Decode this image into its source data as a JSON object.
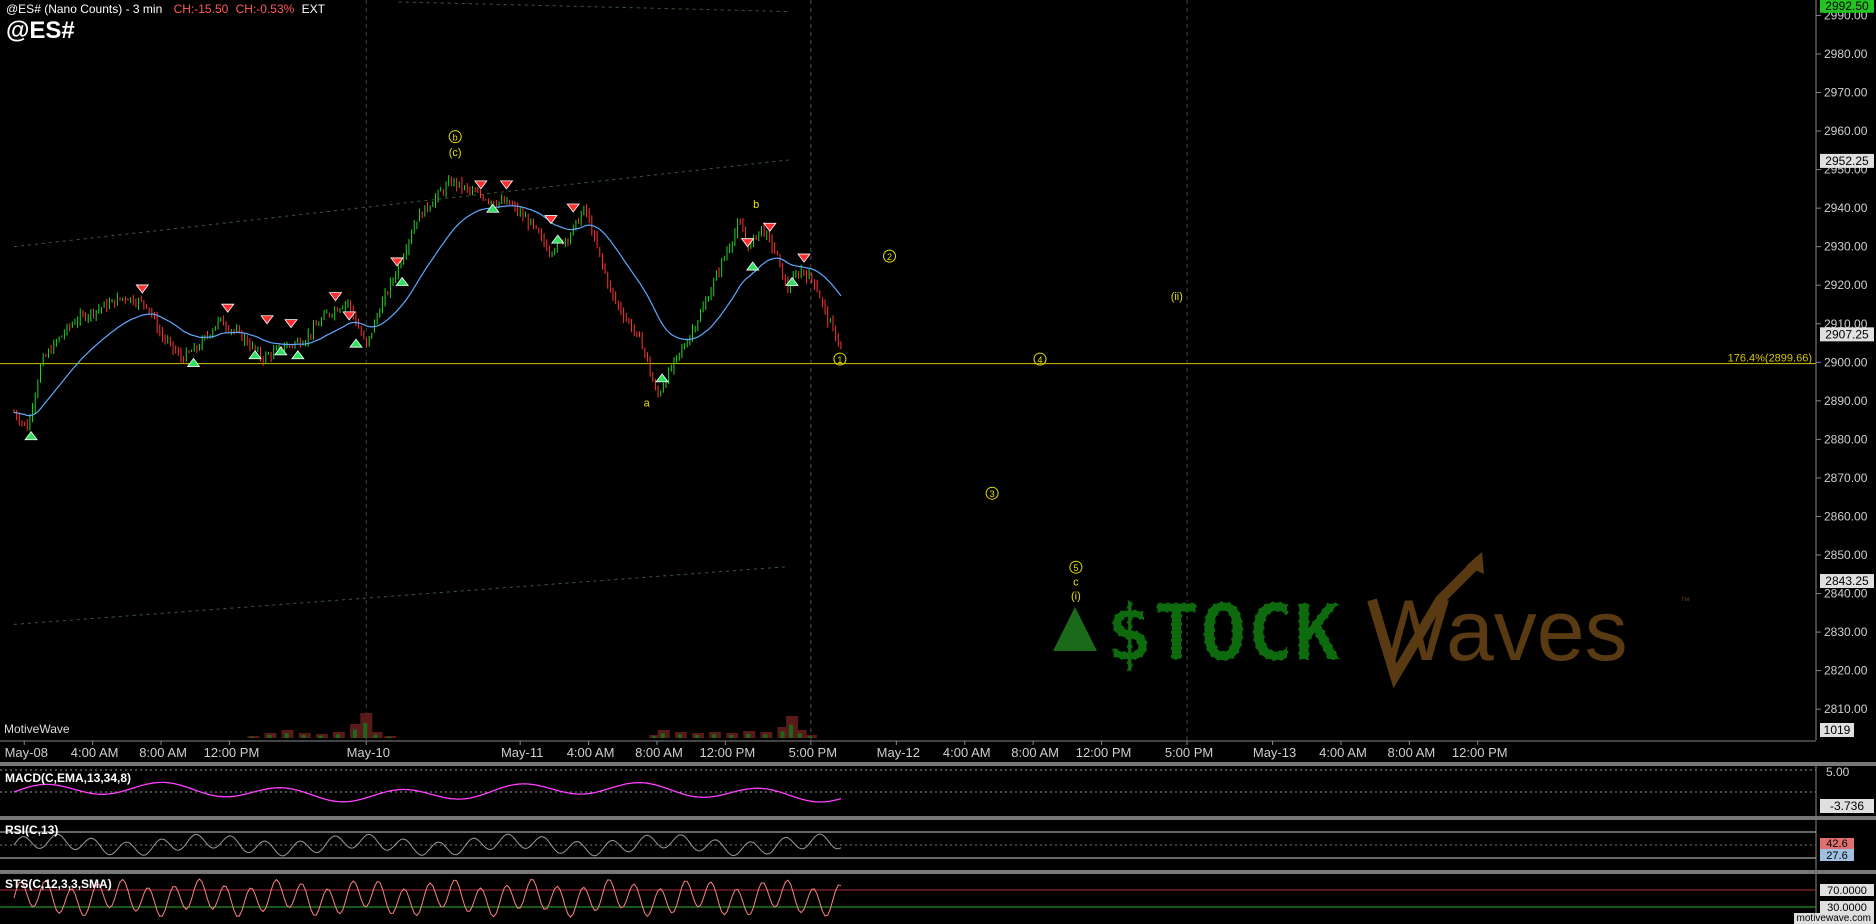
{
  "header": {
    "title": "@ES# (Nano Counts) - 3 min",
    "change_points": "CH:-15.50",
    "change_percent": "CH:-0.53%",
    "session": "EXT",
    "symbol": "@ES#",
    "watermark": "MotiveWave",
    "footer": "motivewave.com"
  },
  "colors": {
    "background": "#000000",
    "bull_candle": "#22d422",
    "bear_candle": "#ff3333",
    "ma_line": "#5fa8ff",
    "level_line": "#d4c400",
    "wave_label": "#e8e000",
    "macd_line": "#ff40ff",
    "rsi_line": "#9a9a9a",
    "stoch_line": "#ff8080"
  },
  "chart_data": {
    "type": "candlestick",
    "title": "@ES# (Nano Counts) - 3 min",
    "price_axis": {
      "ylim": [
        2802,
        2994
      ],
      "ticks": [
        2810,
        2820,
        2830,
        2840,
        2850,
        2860,
        2870,
        2880,
        2890,
        2900,
        2910,
        2920,
        2930,
        2940,
        2950,
        2960,
        2970,
        2980,
        2990
      ],
      "tick_labels": [
        "2810.00",
        "2820.00",
        "2830.00",
        "2840.00",
        "2850.00",
        "2860.00",
        "2870.00",
        "2880.00",
        "2890.00",
        "2900.00",
        "2910.00",
        "2920.00",
        "2930.00",
        "2940.00",
        "2950.00",
        "2960.00",
        "2970.00",
        "2980.00",
        "2990.00"
      ],
      "highlight_tags": [
        {
          "value": 2992.5,
          "label": "2992.50",
          "color": "#22c422"
        },
        {
          "value": 2952.25,
          "label": "2952.25",
          "color": "#e0e0e0"
        },
        {
          "value": 2907.25,
          "label": "2907.25",
          "color": "#e0e0e0"
        },
        {
          "value": 2843.25,
          "label": "2843.25",
          "color": "#e0e0e0"
        }
      ]
    },
    "time_axis": {
      "labels": [
        "May-08",
        "4:00 AM",
        "8:00 AM",
        "12:00 PM",
        "May-10",
        "May-11",
        "4:00 AM",
        "8:00 AM",
        "12:00 PM",
        "5:00 PM",
        "May-12",
        "4:00 AM",
        "8:00 AM",
        "12:00 PM",
        "5:00 PM",
        "May-13",
        "4:00 AM",
        "8:00 AM",
        "12:00 PM"
      ],
      "slot": [
        0.6,
        4.6,
        8.6,
        12.6,
        20.6,
        29.6,
        33.6,
        37.6,
        41.6,
        46.6,
        51.6,
        55.6,
        59.6,
        63.6,
        68.6,
        73.6,
        77.6,
        81.6,
        85.6
      ],
      "slot_max": 94.5,
      "session_breaks": [
        20.6,
        46.6,
        68.6
      ]
    },
    "price_path": [
      [
        0.0,
        2887
      ],
      [
        0.8,
        2883
      ],
      [
        1.6,
        2900
      ],
      [
        2.6,
        2906
      ],
      [
        3.6,
        2911
      ],
      [
        5.0,
        2914
      ],
      [
        6.5,
        2917
      ],
      [
        7.8,
        2915
      ],
      [
        8.6,
        2907
      ],
      [
        9.8,
        2901
      ],
      [
        10.8,
        2904
      ],
      [
        12.0,
        2911
      ],
      [
        13.5,
        2906
      ],
      [
        14.5,
        2901
      ],
      [
        15.8,
        2904
      ],
      [
        17.0,
        2906
      ],
      [
        18.2,
        2912
      ],
      [
        19.5,
        2916
      ],
      [
        20.6,
        2904
      ],
      [
        21.3,
        2913
      ],
      [
        22.5,
        2925
      ],
      [
        23.5,
        2937
      ],
      [
        24.5,
        2942
      ],
      [
        25.6,
        2947
      ],
      [
        26.8,
        2944
      ],
      [
        28.0,
        2942
      ],
      [
        29.0,
        2941
      ],
      [
        30.2,
        2936
      ],
      [
        31.3,
        2929
      ],
      [
        32.5,
        2933
      ],
      [
        33.4,
        2940
      ],
      [
        34.2,
        2928
      ],
      [
        35.0,
        2917
      ],
      [
        36.0,
        2910
      ],
      [
        36.8,
        2904
      ],
      [
        37.6,
        2891
      ],
      [
        38.4,
        2898
      ],
      [
        39.4,
        2906
      ],
      [
        40.4,
        2915
      ],
      [
        41.4,
        2926
      ],
      [
        42.4,
        2936
      ],
      [
        43.0,
        2930
      ],
      [
        43.7,
        2935
      ],
      [
        44.5,
        2929
      ],
      [
        45.2,
        2919
      ],
      [
        46.0,
        2924
      ],
      [
        46.8,
        2921
      ],
      [
        47.6,
        2911
      ],
      [
        48.5,
        2903
      ]
    ],
    "volume_baseline": 0,
    "volume_profile": [
      [
        14.0,
        2
      ],
      [
        15.0,
        5
      ],
      [
        16.0,
        8
      ],
      [
        17.0,
        5
      ],
      [
        18.0,
        4
      ],
      [
        19.0,
        6
      ],
      [
        20.0,
        14
      ],
      [
        20.6,
        25
      ],
      [
        21.2,
        6
      ],
      [
        22.0,
        2
      ],
      [
        37.5,
        3
      ],
      [
        38.0,
        8
      ],
      [
        39.0,
        6
      ],
      [
        40.0,
        5
      ],
      [
        41.0,
        6
      ],
      [
        42.0,
        5
      ],
      [
        43.0,
        7
      ],
      [
        44.0,
        6
      ],
      [
        45.0,
        11
      ],
      [
        45.5,
        22
      ],
      [
        46.0,
        8
      ],
      [
        46.6,
        3
      ]
    ],
    "moving_average": {
      "name": "EMA",
      "color": "#5fa8ff"
    },
    "trendlines": [
      {
        "from": [
          0.0,
          2930.0
        ],
        "to": [
          45.3,
          2952.5
        ]
      },
      {
        "from": [
          0.0,
          2832.0
        ],
        "to": [
          45.3,
          2847.0
        ]
      },
      {
        "from": [
          22.5,
          2993.5
        ],
        "to": [
          45.3,
          2991.0
        ]
      }
    ],
    "horizontal_level": {
      "value": 2899.66,
      "label": "176.4%(2899.66)"
    },
    "wave_labels": [
      {
        "text": "b",
        "slot": 25.8,
        "value": 2957.5,
        "circled": true
      },
      {
        "text": "(c)",
        "slot": 25.8,
        "value": 2953.5,
        "circled": false
      },
      {
        "text": "b",
        "slot": 43.4,
        "value": 2940.0,
        "circled": false
      },
      {
        "text": "a",
        "slot": 37.0,
        "value": 2888.5,
        "circled": false
      },
      {
        "text": "1",
        "slot": 48.3,
        "value": 2899.8,
        "circled": true
      },
      {
        "text": "2",
        "slot": 51.2,
        "value": 2926.5,
        "circled": true
      },
      {
        "text": "(ii)",
        "slot": 68.0,
        "value": 2916.2,
        "circled": false
      },
      {
        "text": "4",
        "slot": 60.0,
        "value": 2899.8,
        "circled": true
      },
      {
        "text": "3",
        "slot": 57.2,
        "value": 2865.0,
        "circled": true
      },
      {
        "text": "5",
        "slot": 62.1,
        "value": 2845.8,
        "circled": true
      },
      {
        "text": "c",
        "slot": 62.1,
        "value": 2842.1,
        "circled": false
      },
      {
        "text": "(i)",
        "slot": 62.1,
        "value": 2838.5,
        "circled": false
      }
    ],
    "signals": [
      {
        "slot": 1.0,
        "value": 2882,
        "dir": "up"
      },
      {
        "slot": 7.5,
        "value": 2918,
        "dir": "down"
      },
      {
        "slot": 10.5,
        "value": 2901,
        "dir": "up"
      },
      {
        "slot": 12.5,
        "value": 2913,
        "dir": "down"
      },
      {
        "slot": 14.1,
        "value": 2903,
        "dir": "up"
      },
      {
        "slot": 14.8,
        "value": 2910,
        "dir": "down"
      },
      {
        "slot": 15.6,
        "value": 2904,
        "dir": "up"
      },
      {
        "slot": 16.2,
        "value": 2909,
        "dir": "down"
      },
      {
        "slot": 16.6,
        "value": 2903,
        "dir": "up"
      },
      {
        "slot": 18.8,
        "value": 2916,
        "dir": "down"
      },
      {
        "slot": 19.6,
        "value": 2911,
        "dir": "down"
      },
      {
        "slot": 20.0,
        "value": 2906,
        "dir": "up"
      },
      {
        "slot": 22.4,
        "value": 2925,
        "dir": "down"
      },
      {
        "slot": 22.7,
        "value": 2922,
        "dir": "up"
      },
      {
        "slot": 27.3,
        "value": 2945,
        "dir": "down"
      },
      {
        "slot": 28.0,
        "value": 2941,
        "dir": "up"
      },
      {
        "slot": 28.8,
        "value": 2945,
        "dir": "down"
      },
      {
        "slot": 31.4,
        "value": 2936,
        "dir": "down"
      },
      {
        "slot": 31.8,
        "value": 2933,
        "dir": "up"
      },
      {
        "slot": 32.7,
        "value": 2939,
        "dir": "down"
      },
      {
        "slot": 37.9,
        "value": 2897,
        "dir": "up"
      },
      {
        "slot": 42.9,
        "value": 2930,
        "dir": "down"
      },
      {
        "slot": 43.2,
        "value": 2926,
        "dir": "up"
      },
      {
        "slot": 44.2,
        "value": 2934,
        "dir": "down"
      },
      {
        "slot": 45.5,
        "value": 2922,
        "dir": "up"
      },
      {
        "slot": 46.2,
        "value": 2926,
        "dir": "down"
      }
    ],
    "indicators": [
      {
        "name": "MACD",
        "label": "MACD(C,EMA,13,34,8)",
        "ref_line": "5.00",
        "value_tag": "-3.736"
      },
      {
        "name": "RSI",
        "label": "RSI(C,13)",
        "value_tag_top": "42.6",
        "value_tag": "27.6"
      },
      {
        "name": "Stochastic",
        "label": "STS(C,12,3,3,SMA)",
        "value_tag_top": "70.0000",
        "value_tag": "30.0000"
      }
    ],
    "volume_tag": "1019",
    "logo": {
      "text_left": "$TOCK",
      "text_right": "Waves",
      "tm": "™"
    }
  }
}
